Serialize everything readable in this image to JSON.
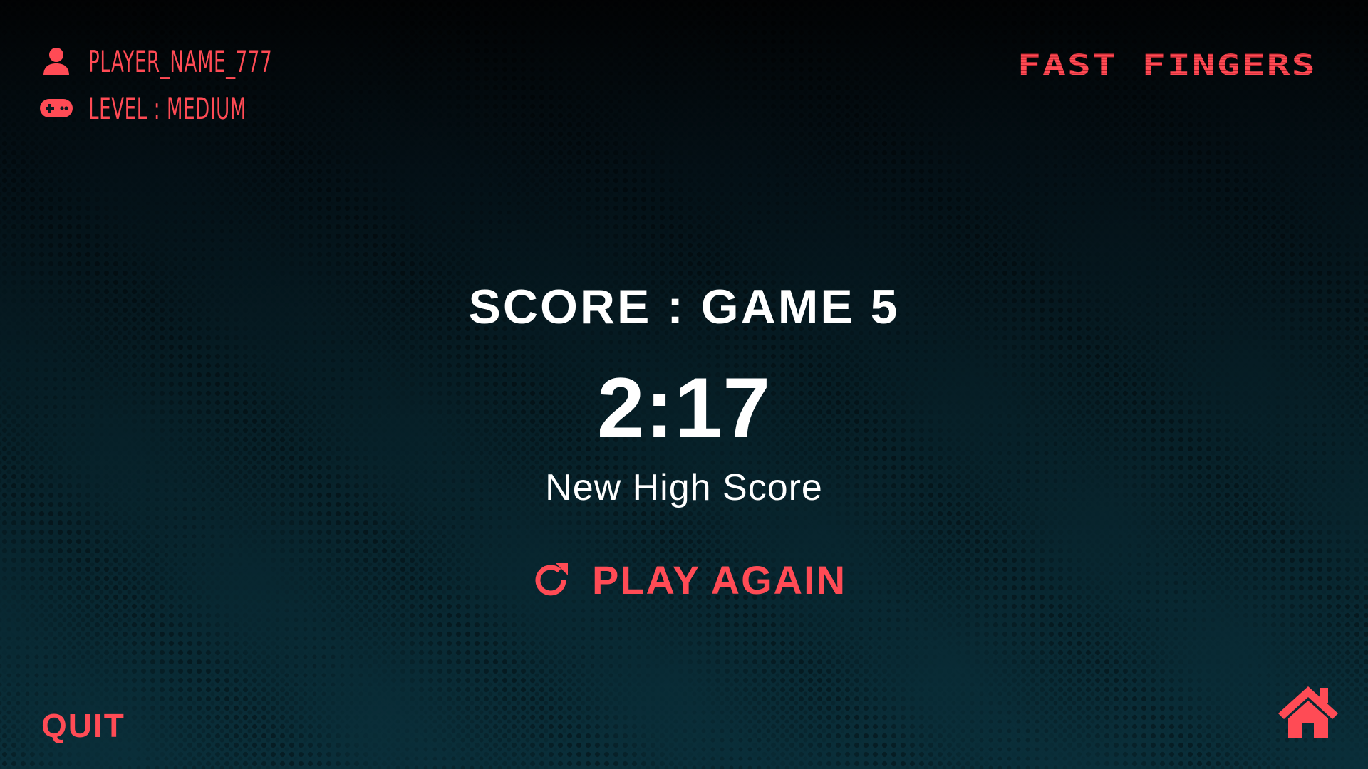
{
  "player": {
    "name": "PLAYER_NAME_777",
    "level": "LEVEL : MEDIUM",
    "player_icon": "user-icon",
    "level_icon": "gamepad-icon"
  },
  "logo": {
    "text": "FAST FINGERS"
  },
  "result": {
    "title": "SCORE : GAME 5",
    "time": "2:17",
    "note": "New High Score"
  },
  "actions": {
    "play_again_label": "PLAY AGAIN",
    "play_again_icon": "refresh-icon",
    "quit_label": "QUIT",
    "home_icon": "home-icon"
  },
  "colors": {
    "accent": "#ff4b55",
    "text": "#ffffff",
    "background_top": "#020304",
    "background_bottom": "#0a2f3a"
  }
}
